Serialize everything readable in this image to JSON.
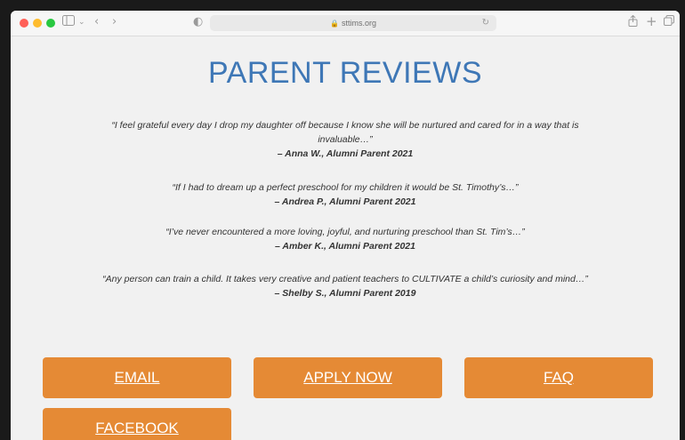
{
  "browser": {
    "url": "sttims.org",
    "colors": {
      "close": "#ff5f57",
      "minimize": "#febc2e",
      "maximize": "#28c840"
    },
    "icons": {
      "sidebar": "sidebar-icon",
      "back": "chevron-left-icon",
      "forward": "chevron-right-icon",
      "privacy": "shield-half-icon",
      "reload": "reload-icon",
      "share": "share-icon",
      "new_tab": "plus-icon",
      "tabs": "tab-overview-icon"
    }
  },
  "page": {
    "title": "PARENT REVIEWS",
    "accent_color": "#3e77b6",
    "button_color": "#e58a35",
    "reviews": [
      {
        "quote": "“I feel grateful every day I drop my daughter off because I know she will be nurtured and cared for in a way that is invaluable…”",
        "author": "– Anna W., Alumni Parent 2021"
      },
      {
        "quote": "“If I had to dream up a perfect preschool for my children it would be St. Timothy’s…”",
        "author": "– Andrea P., Alumni Parent 2021"
      },
      {
        "quote": "“I’ve never encountered a more loving, joyful, and nurturing preschool than St. Tim’s…”",
        "author": "– Amber K., Alumni Parent 2021"
      },
      {
        "quote": "“Any person can train a child. It takes very creative and patient teachers to CULTIVATE a child’s curiosity and mind…”",
        "author": "– Shelby S., Alumni Parent 2019"
      }
    ],
    "buttons": {
      "email": "EMAIL",
      "apply": "APPLY NOW",
      "faq": "FAQ",
      "facebook": "FACEBOOK"
    }
  }
}
